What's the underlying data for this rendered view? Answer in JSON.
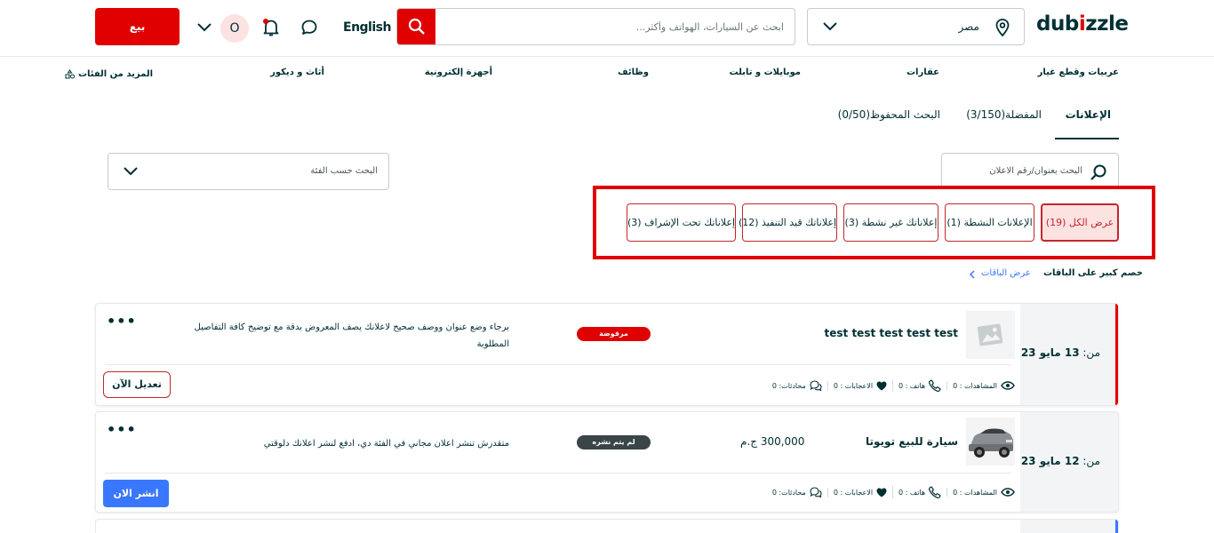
{
  "header": {
    "logo_text": "dubizzle",
    "location": "مصر",
    "search_placeholder": "ابحث عن السيارات، الهواتف وأكثر...",
    "language": "English",
    "avatar_initial": "O",
    "sell_label": "بيع"
  },
  "categories": [
    "عربيات وقطع غيار",
    "عقارات",
    "موبايلات و تابلت",
    "وظائف",
    "أجهزة إلكترونية",
    "أثاث و ديكور",
    "المزيد من الفئات"
  ],
  "tabs": [
    {
      "label": "الإعلانات",
      "active": true
    },
    {
      "label": "المفضلة(3/150)",
      "active": false
    },
    {
      "label": "البحث المحفوظ(0/50)",
      "active": false
    }
  ],
  "filters": {
    "ad_search_placeholder": "البحث بعنوان/رقم الاعلان",
    "category_select": "البحث حسب الفئة"
  },
  "status_pills": [
    {
      "label": "عرض الكل (19)",
      "active": true
    },
    {
      "label": "الإعلانات النشطة (1)",
      "active": false
    },
    {
      "label": "إعلاناتك غير نشطة (3)",
      "active": false
    },
    {
      "label": "إعلاناتك قيد التنفيذ (12)",
      "active": false
    },
    {
      "label": "إعلاناتك تحت الإشراف (3)",
      "active": false
    }
  ],
  "promo": {
    "text": "خصم كبير على الباقات",
    "link": "عرض الباقات"
  },
  "ads": [
    {
      "date_prefix": "من:",
      "date": "13 مايو 23",
      "title": "test test test test test",
      "badge": "مرفوضة",
      "badge_color": "#e00000",
      "message": "برجاء وضع عنوان ووصف صحيح لاعلانك يصف المعروض بدقة مع توضيح كافة التفاصيل المطلوبة",
      "price": "",
      "stats": {
        "views": "المشاهدات : 0",
        "phone": "هاتف : 0",
        "likes": "الاعجابات : 0",
        "chats": "محادثات: 0"
      },
      "action": "تعديل الآن",
      "accent": "#e00000"
    },
    {
      "date_prefix": "من:",
      "date": "12 مايو 23",
      "title": "سيارة للبيع تويوتا",
      "badge": "لم يتم نشره",
      "badge_color": "#3a4548",
      "message": "متقدرش تنشر اعلان مجاني في الفئة دي، ادفع لنشر اعلانك دلوقتي",
      "price": "300,000 ج.م",
      "stats": {
        "views": "المشاهدات : 0",
        "phone": "هاتف : 0",
        "likes": "الاعجابات : 0",
        "chats": "محادثات: 0"
      },
      "action": "انشر الان",
      "accent": "#f2f4f5"
    }
  ],
  "colors": {
    "brand": "#e00000",
    "link": "#3a77ff",
    "ink": "#002f34"
  }
}
